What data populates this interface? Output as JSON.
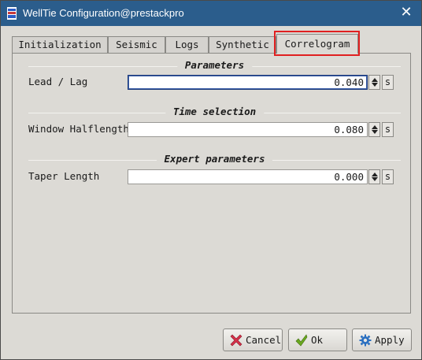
{
  "window": {
    "title": "WellTie Configuration@prestackpro",
    "close_glyph": "✕"
  },
  "tabs": [
    {
      "label": "Initialization",
      "active": false
    },
    {
      "label": "Seismic",
      "active": false
    },
    {
      "label": "Logs",
      "active": false
    },
    {
      "label": "Synthetic",
      "active": false
    },
    {
      "label": "Correlogram",
      "active": true
    }
  ],
  "sections": {
    "parameters": "Parameters",
    "time_selection": "Time selection",
    "expert_parameters": "Expert parameters"
  },
  "fields": {
    "lead_lag": {
      "label": "Lead / Lag",
      "value": "0.040",
      "unit": "s"
    },
    "window_halflength": {
      "label": "Window Halflength",
      "value": "0.080",
      "unit": "s"
    },
    "taper_length": {
      "label": "Taper Length",
      "value": "0.000",
      "unit": "s"
    }
  },
  "buttons": {
    "cancel": {
      "label": "Cancel",
      "icon": "cancel-x-icon"
    },
    "ok": {
      "label": "Ok",
      "icon": "check-icon"
    },
    "apply": {
      "label": "Apply",
      "icon": "gear-icon"
    }
  },
  "colors": {
    "titlebar": "#2b5d8c",
    "highlight": "#e02020",
    "cancel_icon": "#d6304a",
    "ok_icon": "#6aa81f",
    "apply_icon": "#2a6fc0"
  }
}
